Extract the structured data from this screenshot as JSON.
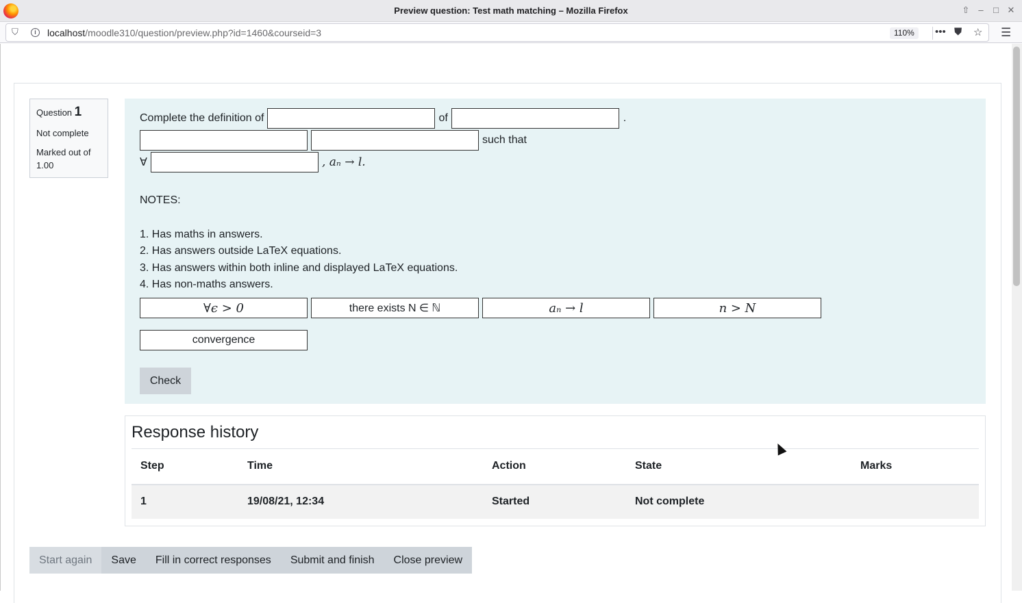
{
  "window": {
    "title": "Preview question: Test math matching – Mozilla Firefox"
  },
  "browser": {
    "url_host": "localhost",
    "url_path": "/moodle310/question/preview.php?id=1460&courseid=3",
    "zoom": "110%"
  },
  "question_info": {
    "question_label": "Question",
    "question_number": "1",
    "state": "Not complete",
    "marks": "Marked out of 1.00"
  },
  "question": {
    "text_prefix": "Complete the definition of",
    "text_of": "of",
    "text_period": ".",
    "text_such_that": "such that",
    "forall": "∀",
    "text_tail": ", aₙ → l.",
    "notes_title": "NOTES:",
    "notes": [
      "1. Has maths in answers.",
      "2. Has answers outside LaTeX equations.",
      "3. Has answers within both inline and displayed LaTeX equations.",
      "4. Has non-maths answers."
    ],
    "choices": [
      "∀ϵ > 0",
      "there exists N ∈ ℕ",
      "aₙ → l",
      "n > N",
      "convergence"
    ],
    "check_label": "Check"
  },
  "history": {
    "title": "Response history",
    "columns": [
      "Step",
      "Time",
      "Action",
      "State",
      "Marks"
    ],
    "rows": [
      [
        "1",
        "19/08/21, 12:34",
        "Started",
        "Not complete",
        ""
      ]
    ]
  },
  "actions": {
    "start_again": "Start again",
    "save": "Save",
    "fill_correct": "Fill in correct responses",
    "submit_finish": "Submit and finish",
    "close_preview": "Close preview"
  }
}
